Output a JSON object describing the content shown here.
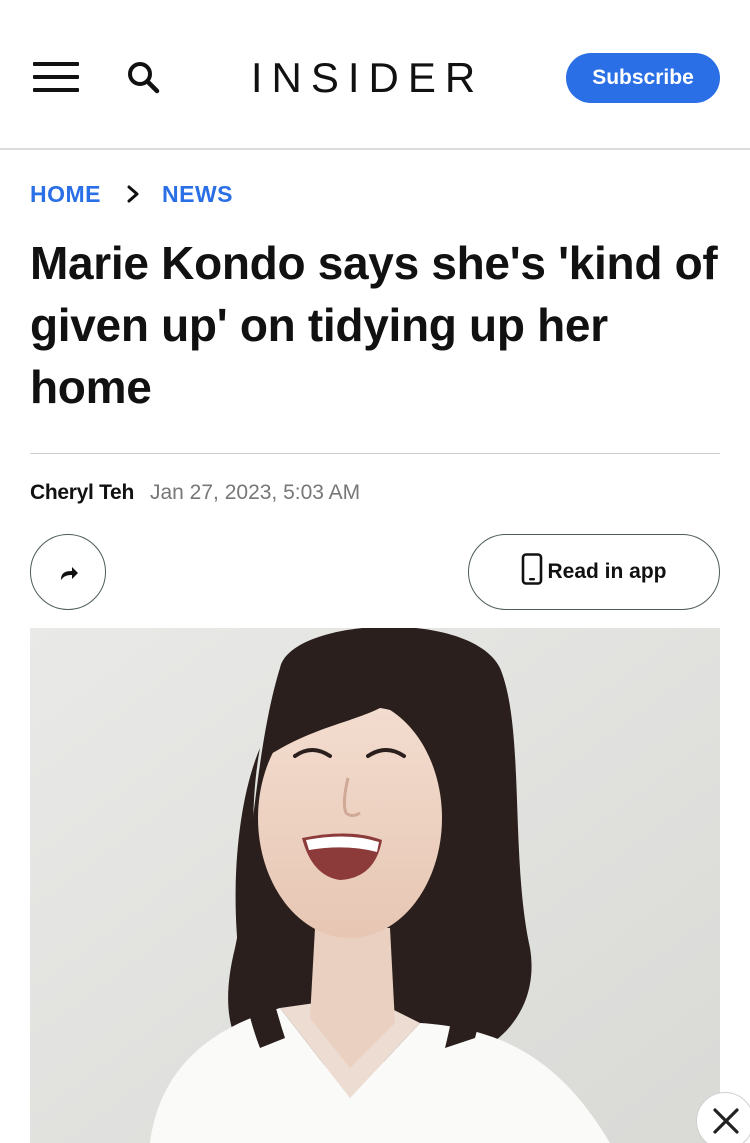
{
  "header": {
    "logo": "INSIDER",
    "subscribe_label": "Subscribe",
    "menu_icon": "hamburger-menu-icon",
    "search_icon": "search-icon"
  },
  "breadcrumb": {
    "items": [
      {
        "label": "HOME"
      },
      {
        "label": "NEWS"
      }
    ],
    "separator_icon": "chevron-right-icon"
  },
  "article": {
    "title": "Marie Kondo says she's 'kind of given up' on tidying up her home",
    "author": "Cheryl Teh",
    "date": "Jan 27, 2023, 5:03 AM"
  },
  "actions": {
    "share_icon": "share-arrow-icon",
    "read_in_app_label": "Read in app",
    "read_in_app_icon": "smartphone-icon"
  },
  "ad": {
    "close_icon": "close-icon"
  },
  "colors": {
    "accent": "#2a6fe6",
    "text": "#111111",
    "muted": "#777777",
    "button_border": "#4d5b5a"
  }
}
